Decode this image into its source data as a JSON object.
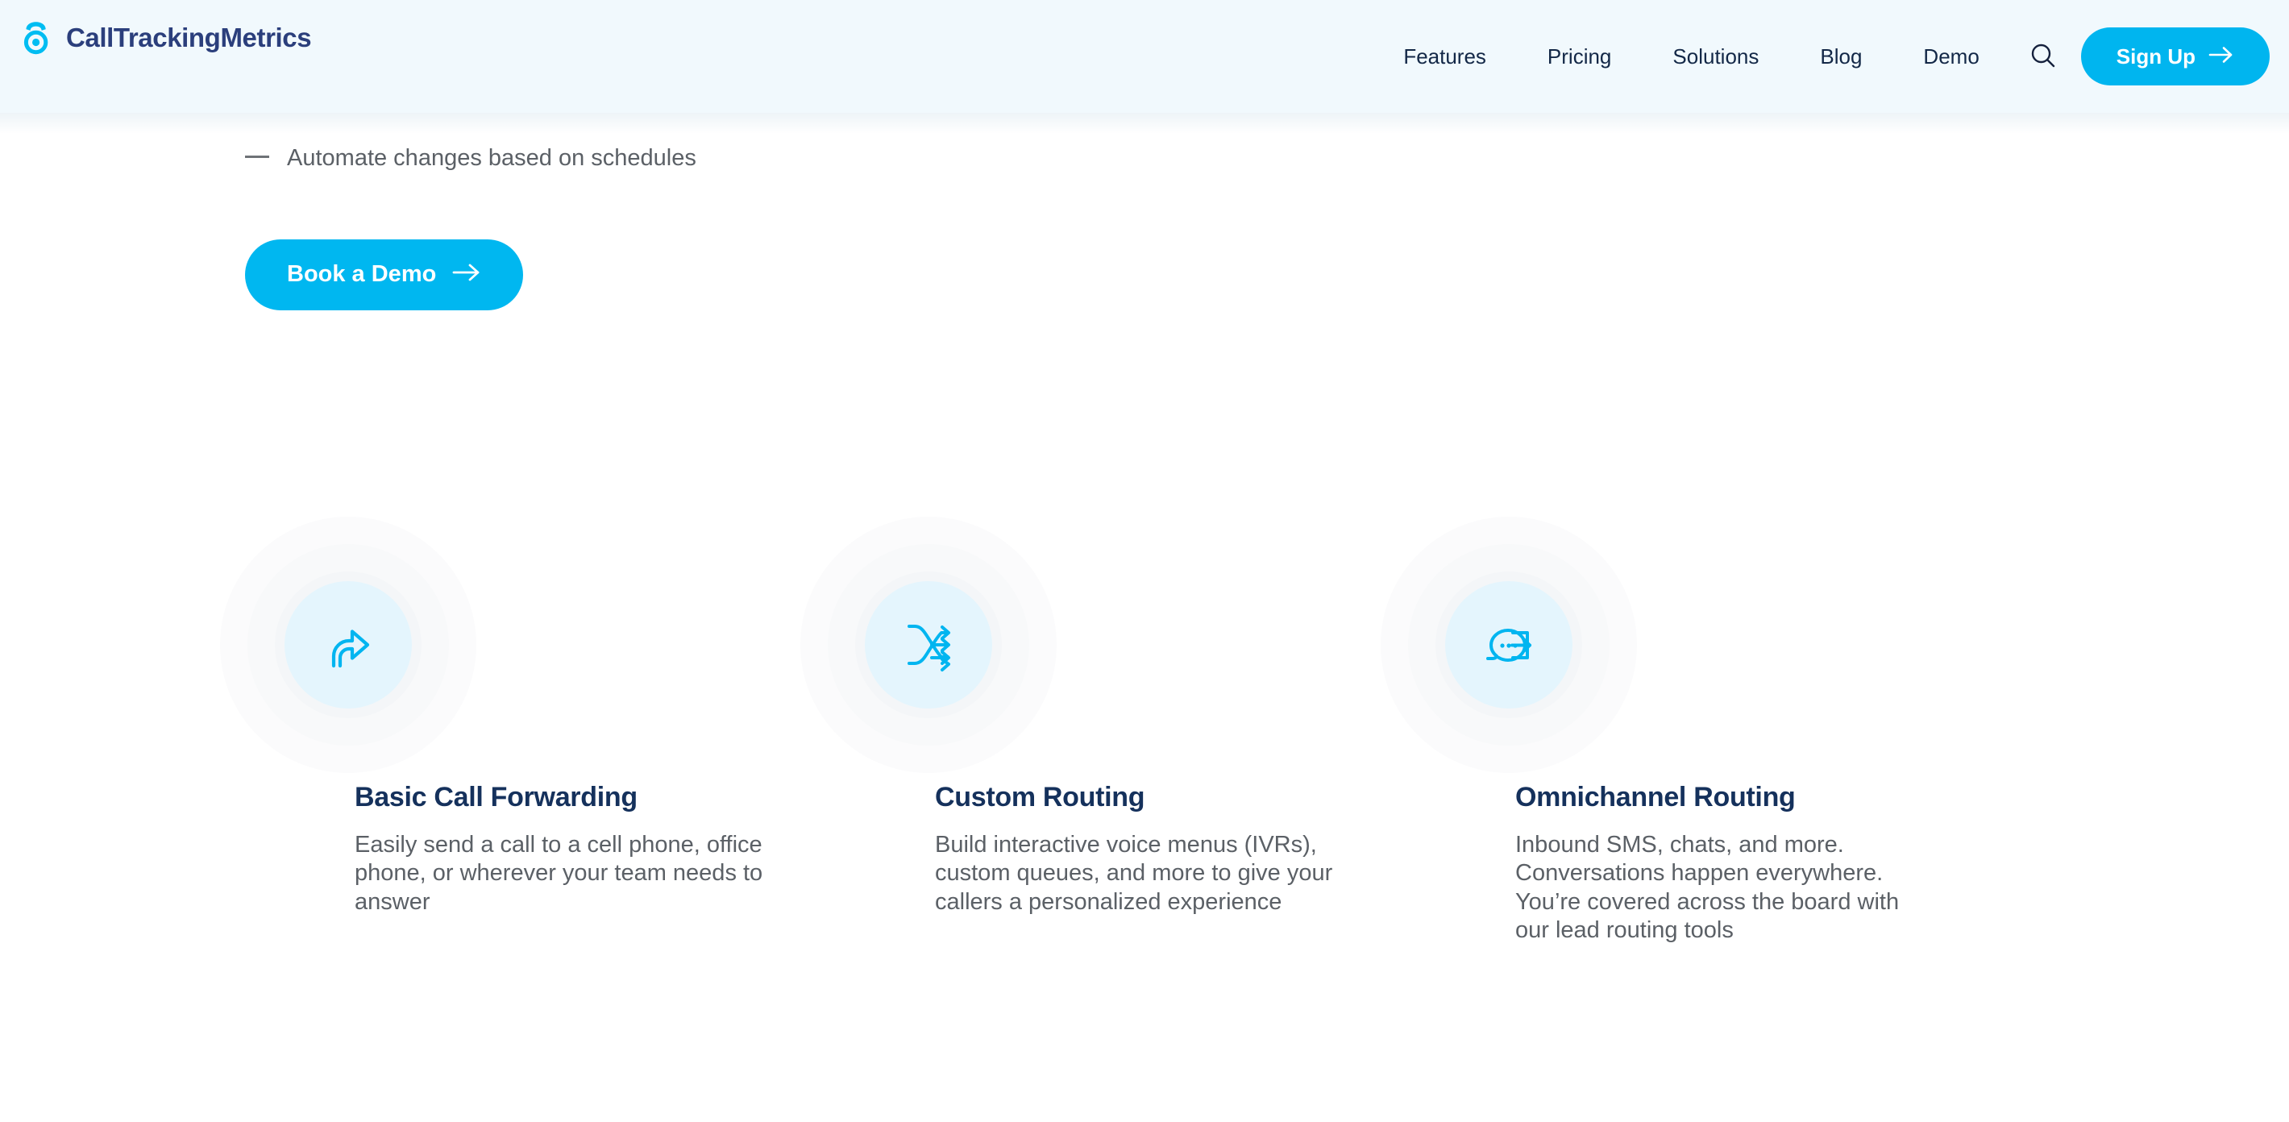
{
  "brand": {
    "name": "CallTrackingMetrics",
    "logo_icon": "phone-ring-logo-icon"
  },
  "header": {
    "background_color": "#f1f9fd",
    "nav_items": [
      {
        "label": "Features"
      },
      {
        "label": "Pricing"
      },
      {
        "label": "Solutions"
      },
      {
        "label": "Blog"
      },
      {
        "label": "Demo"
      }
    ],
    "search_icon": "search-icon",
    "signup": {
      "label": "Sign Up",
      "arrow_icon": "arrow-right-icon",
      "background_color": "#00b5ef"
    }
  },
  "intro": {
    "bullets": [
      {
        "text": "Automate changes based on schedules"
      }
    ],
    "cta": {
      "label": "Book a Demo",
      "arrow_icon": "arrow-right-icon",
      "background_color": "#00b7f0"
    }
  },
  "features": {
    "cards": [
      {
        "icon": "share-forward-arrow-icon",
        "title": "Basic Call Forwarding",
        "body": "Easily send a call to a cell phone, office phone, or wherever your team needs to answer"
      },
      {
        "icon": "crossing-routing-arrows-icon",
        "title": "Custom Routing",
        "body": "Build interactive voice menus (IVRs), custom queues, and more to give your callers a personalized experience"
      },
      {
        "icon": "chat-bubble-diverging-arrows-icon",
        "title": "Omnichannel Routing",
        "body": "Inbound SMS, chats, and more. Conversations happen everywhere. You’re covered across the board with our lead routing tools"
      }
    ],
    "accent_color": "#00b5f0",
    "icon_disc_color": "#e4f5fd",
    "title_color": "#15315c"
  }
}
